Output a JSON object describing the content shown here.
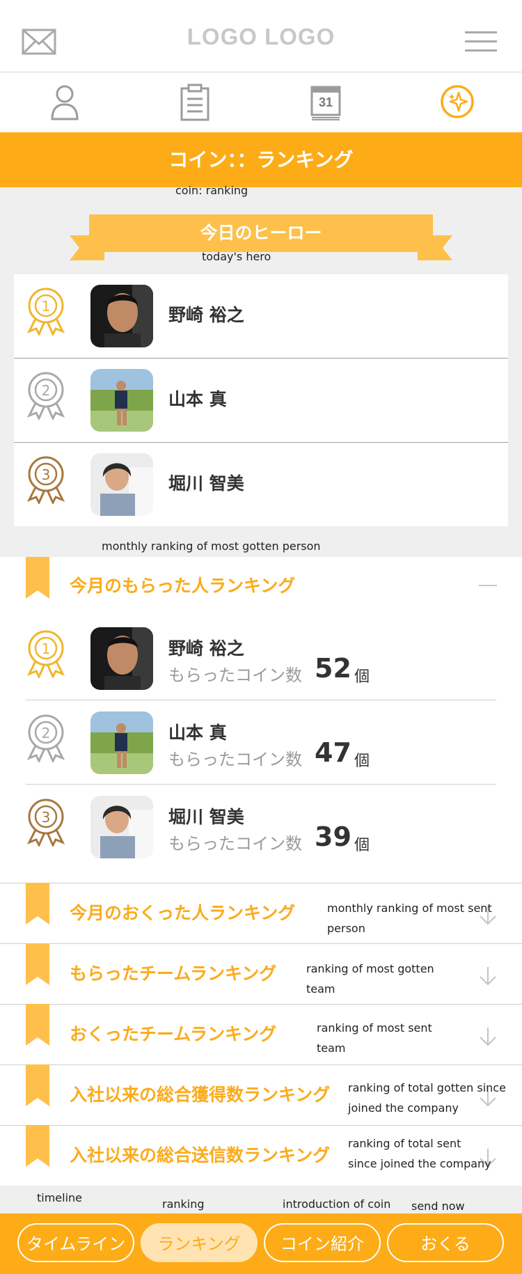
{
  "header": {
    "logo": "LOGO LOGO",
    "mail_icon": "mail-icon",
    "menu_icon": "hamburger-menu-icon"
  },
  "nav": {
    "icons": [
      "person-icon",
      "clipboard-icon",
      "calendar-icon",
      "coin-sparkle-icon"
    ],
    "calendar_day": "31",
    "active_color": "#fdac17",
    "inactive_color": "#9b9b9b"
  },
  "page": {
    "title": "コイン：：ランキング",
    "title_note": "coin: ranking"
  },
  "hero": {
    "ribbon_label": "今日のヒーロー",
    "ribbon_note": "today's hero",
    "items": [
      {
        "rank": "1",
        "name": "野崎 裕之"
      },
      {
        "rank": "2",
        "name": "山本 真"
      },
      {
        "rank": "3",
        "name": "堀川 智美"
      }
    ]
  },
  "monthly_received": {
    "note": "monthly ranking of most gotten person",
    "title": "今月のもらった人ランキング",
    "collapse_icon": "minus-icon",
    "coin_label": "もらったコイン数",
    "unit": "個",
    "items": [
      {
        "rank": "1",
        "name": "野崎 裕之",
        "count": "52"
      },
      {
        "rank": "2",
        "name": "山本 真",
        "count": "47"
      },
      {
        "rank": "3",
        "name": "堀川 智美",
        "count": "39"
      }
    ]
  },
  "sections": [
    {
      "title": "今月のおくった人ランキング",
      "note_line1": "monthly ranking of most sent",
      "note_line2": "person"
    },
    {
      "title": "もらったチームランキング",
      "note_line1": "ranking of most gotten",
      "note_line2": "team"
    },
    {
      "title": "おくったチームランキング",
      "note_line1": "ranking of most sent",
      "note_line2": "team"
    },
    {
      "title": "入社以来の総合獲得数ランキング",
      "note_line1": "ranking of total gotten since",
      "note_line2": "joined the company"
    },
    {
      "title": "入社以来の総合送信数ランキング",
      "note_line1": "ranking of total sent",
      "note_line2": "since joined the company"
    }
  ],
  "bottom_notes": {
    "timeline": "timeline",
    "ranking": "ranking",
    "intro": "introduction of coin",
    "send": "send now"
  },
  "bottom_nav": {
    "timeline": "タイムライン",
    "ranking": "ランキング",
    "intro": "コイン紹介",
    "send": "おくる"
  },
  "colors": {
    "accent": "#fdac17",
    "ribbon": "#fec04b",
    "gold": "#f2b52a",
    "silver": "#a8a8a8",
    "bronze": "#a7773e"
  }
}
